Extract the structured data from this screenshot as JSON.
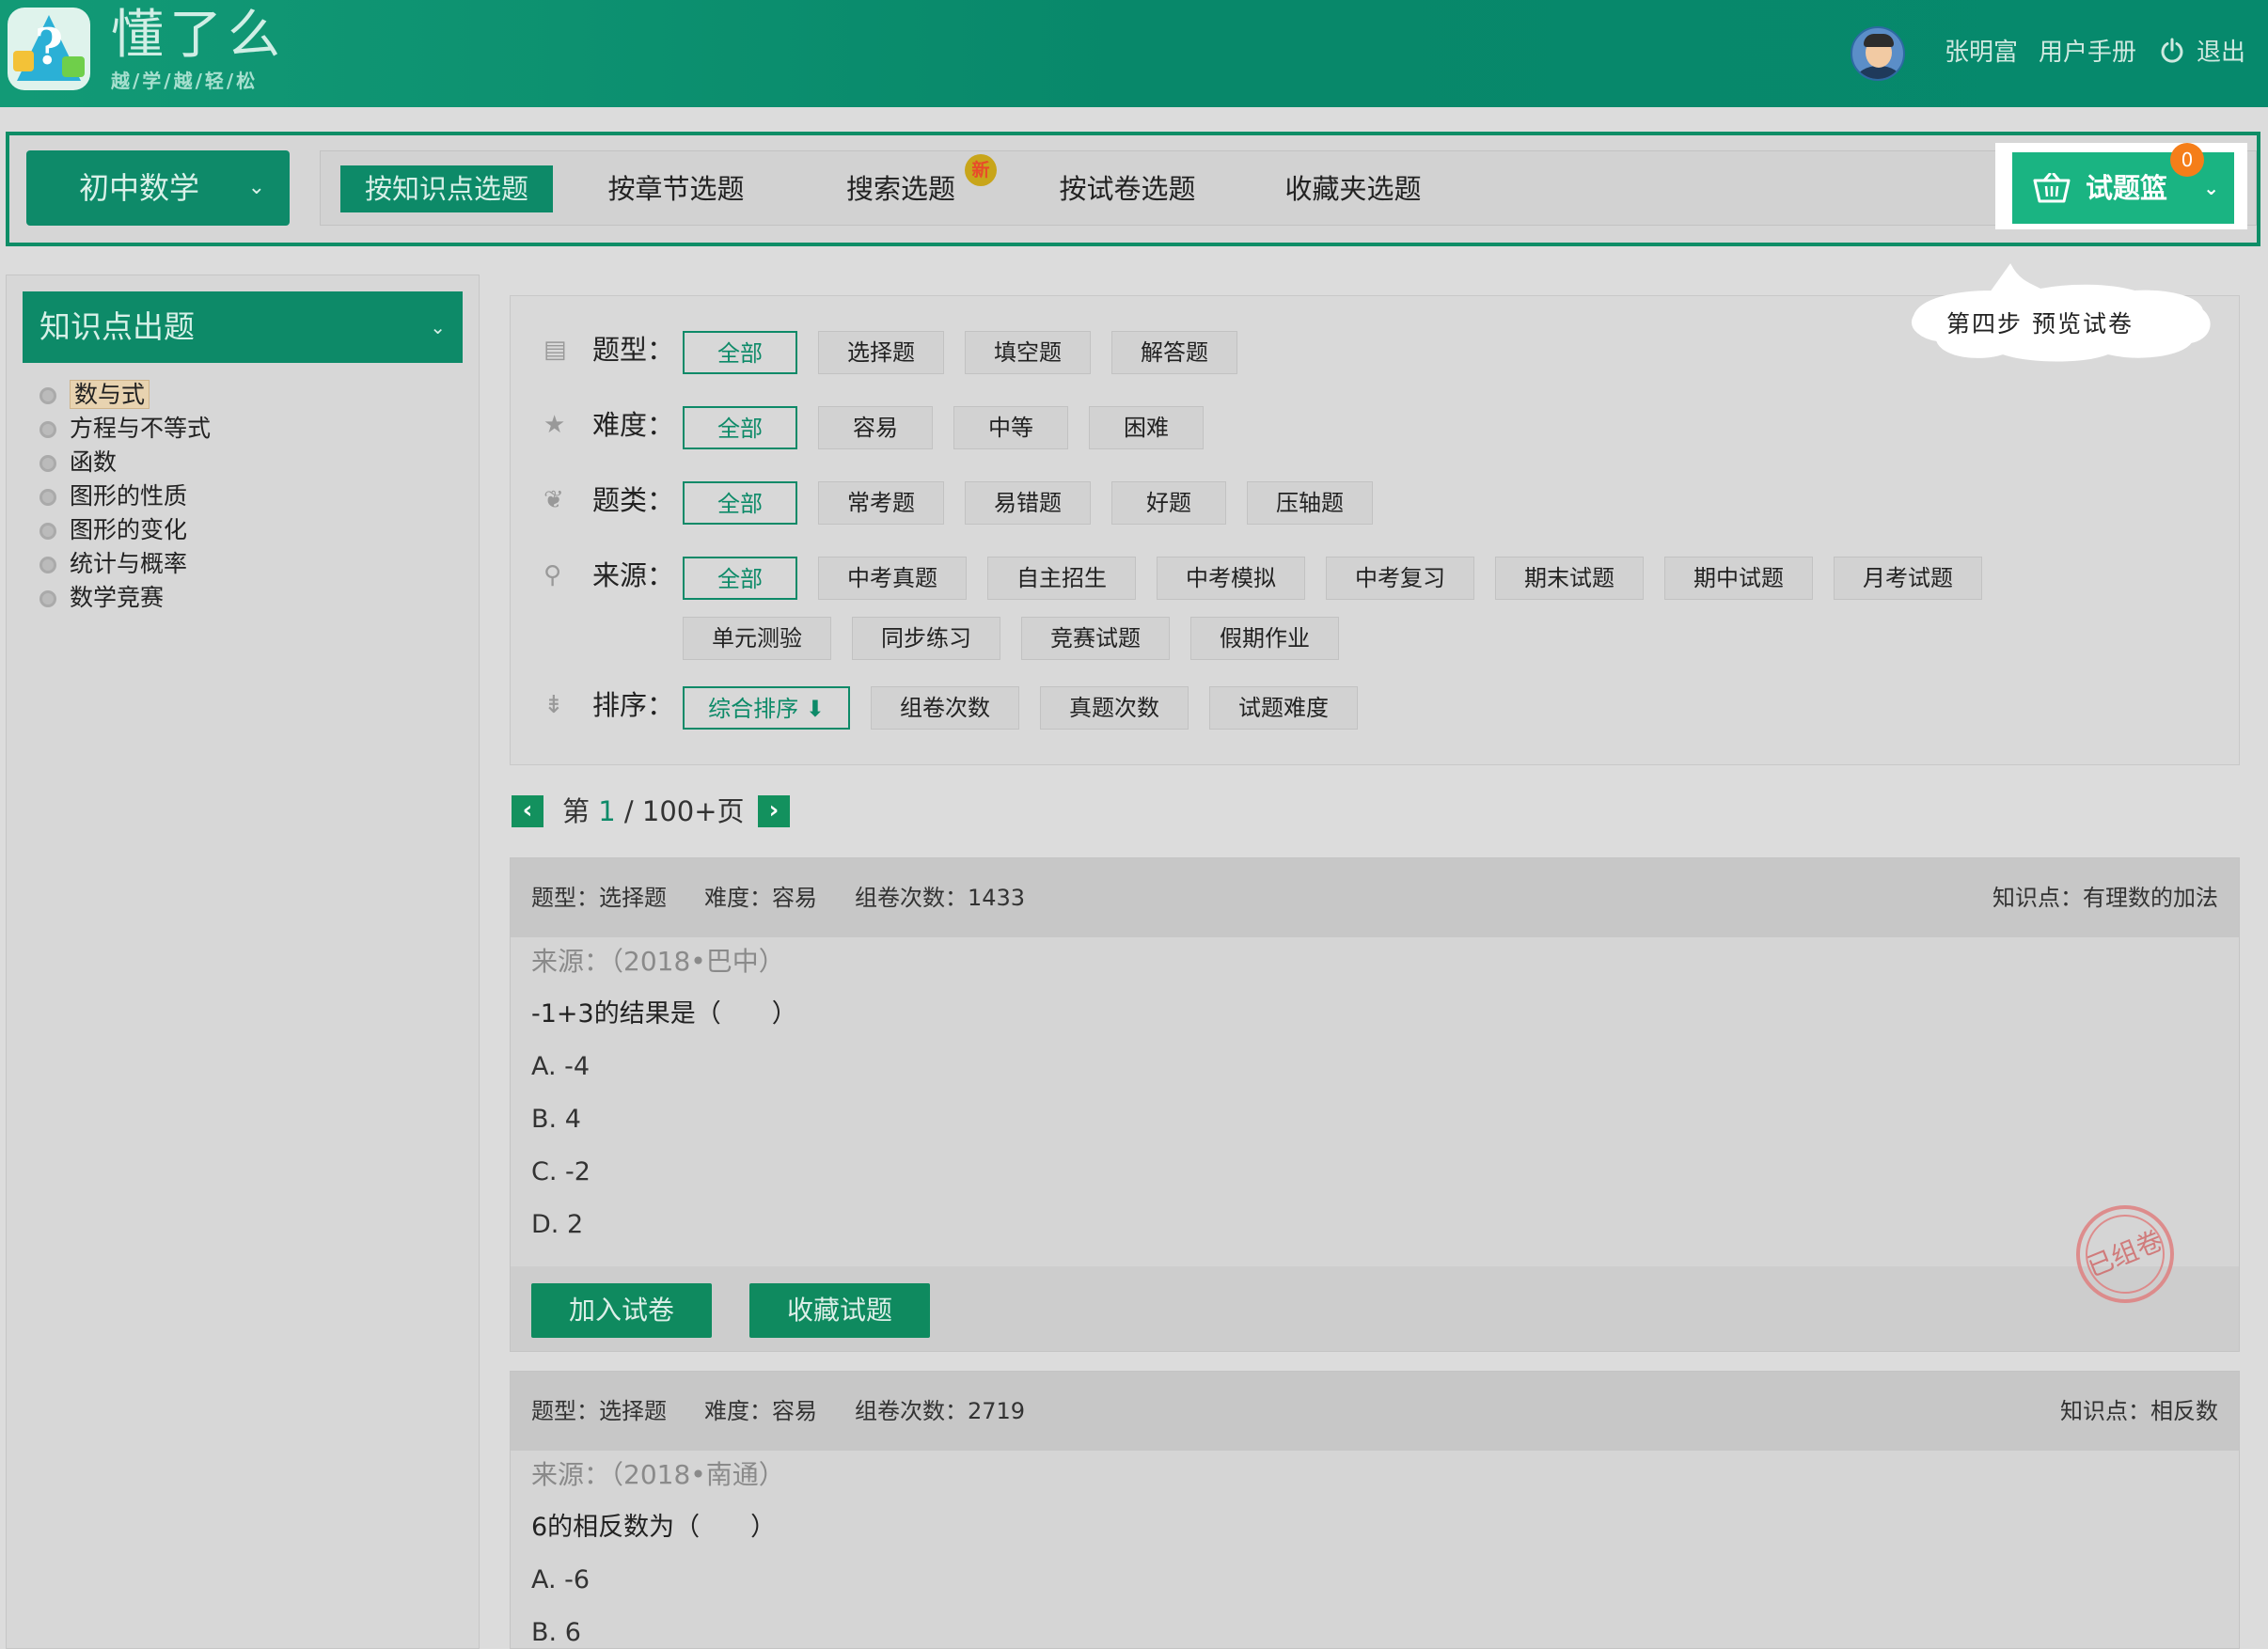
{
  "header": {
    "brand": "懂了么",
    "slogan": "越/学/越/轻/松",
    "user_name": "张明富",
    "manual": "用户手册",
    "logout": "退出"
  },
  "nav": {
    "subject": "初中数学",
    "tabs": [
      {
        "label": "按知识点选题"
      },
      {
        "label": "按章节选题"
      },
      {
        "label": "搜索选题"
      },
      {
        "label": "按试卷选题"
      },
      {
        "label": "收藏夹选题"
      }
    ],
    "new_badge": "新",
    "basket_label": "试题篮",
    "basket_count": "0"
  },
  "sidebar": {
    "title": "知识点出题",
    "items": [
      {
        "label": "数与式"
      },
      {
        "label": "方程与不等式"
      },
      {
        "label": "函数"
      },
      {
        "label": "图形的性质"
      },
      {
        "label": "图形的变化"
      },
      {
        "label": "统计与概率"
      },
      {
        "label": "数学竞赛"
      }
    ]
  },
  "callout": {
    "text": "第四步 预览试卷"
  },
  "filters": {
    "type": {
      "label": "题型：",
      "options": [
        "全部",
        "选择题",
        "填空题",
        "解答题"
      ]
    },
    "difficulty": {
      "label": "难度：",
      "options": [
        "全部",
        "容易",
        "中等",
        "困难"
      ]
    },
    "category": {
      "label": "题类：",
      "options": [
        "全部",
        "常考题",
        "易错题",
        "好题",
        "压轴题"
      ]
    },
    "source": {
      "label": "来源：",
      "options": [
        "全部",
        "中考真题",
        "自主招生",
        "中考模拟",
        "中考复习",
        "期末试题",
        "期中试题",
        "月考试题",
        "单元测验",
        "同步练习",
        "竞赛试题",
        "假期作业"
      ]
    },
    "sort": {
      "label": "排序：",
      "options": [
        "综合排序 ⬇",
        "组卷次数",
        "真题次数",
        "试题难度"
      ]
    }
  },
  "pager": {
    "prefix": "第",
    "current": "1",
    "suffix": "/ 100+页"
  },
  "questions": [
    {
      "type": "题型：选择题",
      "difficulty": "难度：容易",
      "count": "组卷次数：1433",
      "knowledge": "知识点：有理数的加法",
      "source": "来源：（2018•巴中）",
      "stem": "-1+3的结果是（　　）",
      "options": [
        "A. -4",
        "B. 4",
        "C. -2",
        "D. 2"
      ],
      "add_btn": "加入试卷",
      "fav_btn": "收藏试题",
      "stamp": "已组卷"
    },
    {
      "type": "题型：选择题",
      "difficulty": "难度：容易",
      "count": "组卷次数：2719",
      "knowledge": "知识点：相反数",
      "source": "来源：（2018•南通）",
      "stem": "6的相反数为（　　）",
      "options": [
        "A. -6",
        "B. 6"
      ]
    }
  ],
  "colors": {
    "primary": "#0d8a68",
    "header": "#08886a",
    "badge": "#f57e19",
    "basket": "#1ab482"
  }
}
